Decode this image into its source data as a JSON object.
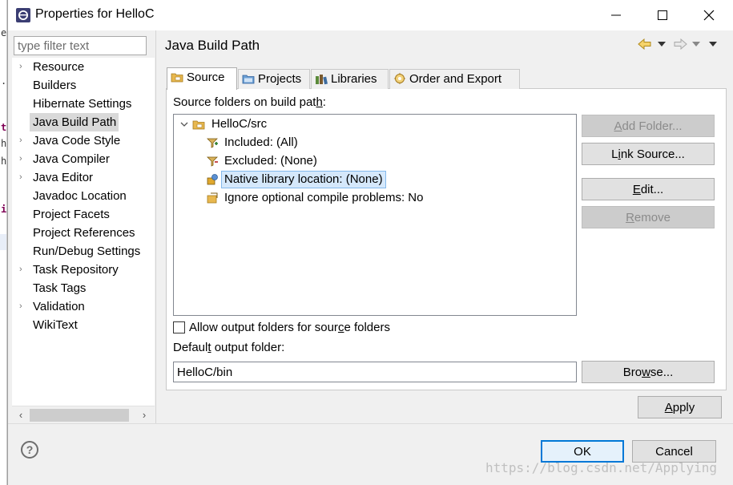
{
  "window": {
    "title": "Properties for HelloC",
    "minimize_glyph": "─",
    "maximize_glyph": "☐",
    "close_glyph": "✕"
  },
  "background_editor": {
    "glyphs": [
      "e",
      ".",
      "t",
      "h",
      "h",
      "i"
    ]
  },
  "filter": {
    "placeholder": "type filter text",
    "value": ""
  },
  "nav": {
    "items": [
      {
        "label": "Resource",
        "expandable": true
      },
      {
        "label": "Builders",
        "expandable": false
      },
      {
        "label": "Hibernate Settings",
        "expandable": false
      },
      {
        "label": "Java Build Path",
        "expandable": false,
        "selected": true
      },
      {
        "label": "Java Code Style",
        "expandable": true
      },
      {
        "label": "Java Compiler",
        "expandable": true
      },
      {
        "label": "Java Editor",
        "expandable": true
      },
      {
        "label": "Javadoc Location",
        "expandable": false
      },
      {
        "label": "Project Facets",
        "expandable": false
      },
      {
        "label": "Project References",
        "expandable": false
      },
      {
        "label": "Run/Debug Settings",
        "expandable": false
      },
      {
        "label": "Task Repository",
        "expandable": true
      },
      {
        "label": "Task Tags",
        "expandable": false
      },
      {
        "label": "Validation",
        "expandable": true
      },
      {
        "label": "WikiText",
        "expandable": false
      }
    ],
    "twisty_glyph": "›",
    "scroll_left": "‹",
    "scroll_right": "›"
  },
  "page": {
    "title": "Java Build Path"
  },
  "tabs": [
    {
      "label": "Source",
      "active": true,
      "icon": "source-folder-icon"
    },
    {
      "label": "Projects",
      "active": false,
      "icon": "projects-icon"
    },
    {
      "label": "Libraries",
      "active": false,
      "icon": "libraries-icon"
    },
    {
      "label": "Order and Export",
      "active": false,
      "icon": "order-export-icon"
    }
  ],
  "source": {
    "label_pre": "Source folders on build pat",
    "label_mnemonic": "h",
    "label_post": ":",
    "tree": {
      "root": "HelloC/src",
      "expand_glyph": "⌄",
      "children": [
        {
          "label": "Included: (All)",
          "icon": "inclusion-filter-icon"
        },
        {
          "label": "Excluded: (None)",
          "icon": "exclusion-filter-icon"
        },
        {
          "label": "Native library location: (None)",
          "icon": "native-library-icon",
          "selected": true
        },
        {
          "label": "Ignore optional compile problems: No",
          "icon": "ignore-problems-icon"
        }
      ]
    },
    "buttons": {
      "add_folder": {
        "pre": "",
        "mn": "A",
        "post": "dd Folder..."
      },
      "link_source": {
        "pre": "L",
        "mn": "i",
        "post": "nk Source..."
      },
      "edit": {
        "pre": "",
        "mn": "E",
        "post": "dit..."
      },
      "remove": {
        "pre": "",
        "mn": "R",
        "post": "emove"
      },
      "browse": {
        "pre": "Bro",
        "mn": "w",
        "post": "se..."
      }
    },
    "allow_output": {
      "checked": false,
      "pre": "Allow output folders for sour",
      "mn": "c",
      "post": "e folders"
    },
    "default_output": {
      "pre": "Defaul",
      "mn": "t",
      "post": " output folder:",
      "value": "HelloC/bin"
    }
  },
  "footer": {
    "apply": {
      "pre": "",
      "mn": "A",
      "post": "pply"
    },
    "ok": "OK",
    "cancel": "Cancel",
    "help_glyph": "?"
  },
  "watermark": "https://blog.csdn.net/Applying",
  "colors": {
    "selection": "#d5e8fb",
    "selection_border": "#84b9ec",
    "default_button_border": "#0078d7",
    "disabled_text": "#8b8b8b"
  }
}
